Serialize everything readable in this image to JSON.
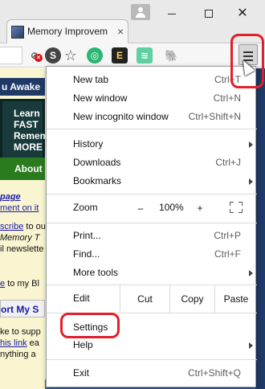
{
  "browser": {
    "tab": {
      "title": "Memory Improvem",
      "close_label": "×"
    },
    "window_controls": {
      "close": "✕"
    },
    "extensions": [
      {
        "name": "blocked-extension-icon",
        "glyph": "⊘"
      },
      {
        "name": "s-extension-icon",
        "glyph": "S"
      },
      {
        "name": "star-icon",
        "glyph": "☆"
      },
      {
        "name": "green-circle-extension-icon",
        "glyph": "◎"
      },
      {
        "name": "e-extension-icon",
        "glyph": "E"
      },
      {
        "name": "waveform-extension-icon",
        "glyph": "≋"
      },
      {
        "name": "elephant-extension-icon",
        "glyph": "🐘"
      }
    ]
  },
  "page": {
    "banner": "u Awake",
    "hero": [
      "Learn",
      "FAST",
      "Remem",
      "MORE"
    ],
    "about": "About",
    "lines": [
      {
        "text": "page",
        "style": "link-bold"
      },
      {
        "text": "ment on it",
        "style": "link"
      },
      {
        "text": "scribe",
        "style": "link",
        "suffix": " to our"
      },
      {
        "text": "Memory T",
        "style": "italic"
      },
      {
        "text": "il newslette",
        "style": "plain"
      },
      {
        "text": "e",
        "style": "link",
        "suffix": " to my Bl"
      },
      {
        "text": "ke to supp",
        "style": "plain"
      },
      {
        "text": "his link",
        "style": "link",
        "suffix": " ea"
      },
      {
        "text": "nything a",
        "style": "plain"
      }
    ],
    "support_box": "ort My S"
  },
  "menu": {
    "new_tab": {
      "label": "New tab",
      "shortcut": "Ctrl+T"
    },
    "new_window": {
      "label": "New window",
      "shortcut": "Ctrl+N"
    },
    "new_incognito": {
      "label": "New incognito window",
      "shortcut": "Ctrl+Shift+N"
    },
    "history": {
      "label": "History"
    },
    "downloads": {
      "label": "Downloads",
      "shortcut": "Ctrl+J"
    },
    "bookmarks": {
      "label": "Bookmarks"
    },
    "zoom": {
      "label": "Zoom",
      "minus": "–",
      "value": "100%",
      "plus": "+"
    },
    "print": {
      "label": "Print...",
      "shortcut": "Ctrl+P"
    },
    "find": {
      "label": "Find...",
      "shortcut": "Ctrl+F"
    },
    "more_tools": {
      "label": "More tools"
    },
    "edit": {
      "label": "Edit",
      "cut": "Cut",
      "copy": "Copy",
      "paste": "Paste"
    },
    "settings": {
      "label": "Settings"
    },
    "help": {
      "label": "Help"
    },
    "exit": {
      "label": "Exit",
      "shortcut": "Ctrl+Shift+Q"
    }
  },
  "annotations": {
    "highlight_color": "#e0202a"
  }
}
